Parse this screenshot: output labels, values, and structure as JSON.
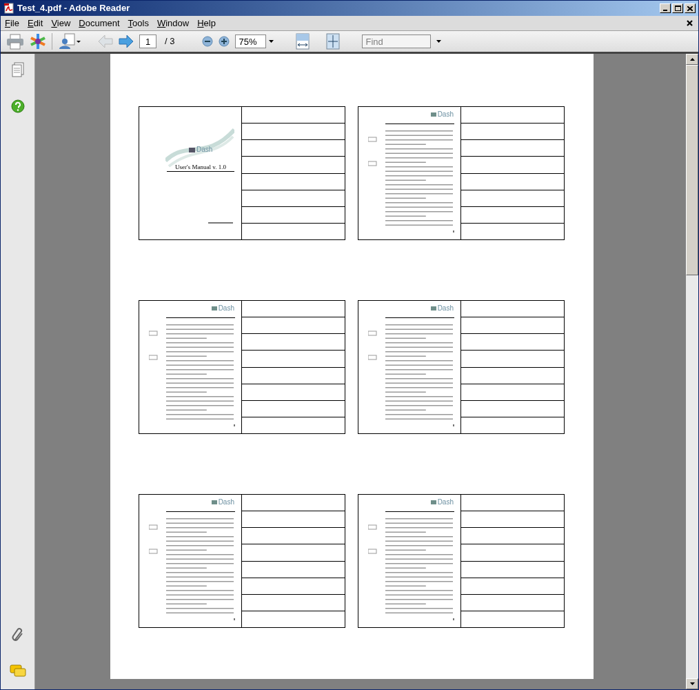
{
  "window": {
    "title": "Test_4.pdf - Adobe Reader"
  },
  "menu": [
    "File",
    "Edit",
    "View",
    "Document",
    "Tools",
    "Window",
    "Help"
  ],
  "toolbar": {
    "page": "1",
    "page_total": "/ 3",
    "zoom": "75%",
    "find_placeholder": "Find"
  },
  "pages": [
    {
      "kind": "cover",
      "logo": "Dash",
      "title": "User's Manual v. 1.0"
    },
    {
      "kind": "text",
      "logo": "Dash"
    },
    {
      "kind": "text",
      "logo": "Dash"
    },
    {
      "kind": "text",
      "logo": "Dash"
    },
    {
      "kind": "text",
      "logo": "Dash"
    },
    {
      "kind": "text",
      "logo": "Dash"
    }
  ]
}
